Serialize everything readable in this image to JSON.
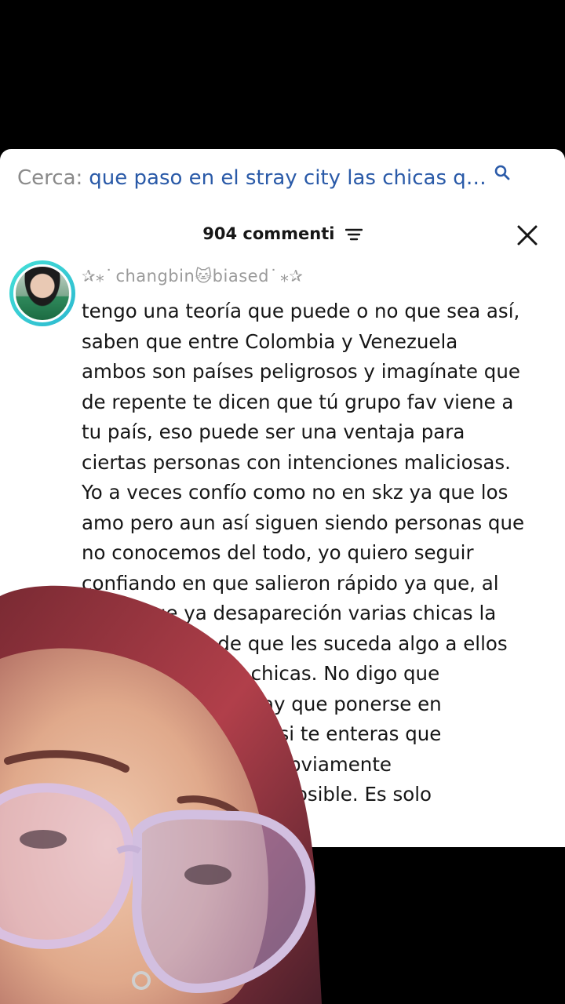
{
  "search": {
    "prefix": "Cerca:",
    "query": "que paso en el stray city las chicas qu..."
  },
  "comments": {
    "count_label": "904 commenti"
  },
  "comment": {
    "username": "✰⁎ ͘ changbin🐱biased ͘ ⁎✰",
    "lines": [
      "tengo una teoría que puede o no que sea así,",
      "saben que entre Colombia y Venezuela",
      "ambos son países peligrosos y imagínate que",
      "de repente te dicen que tú grupo fav viene a",
      "tu país, eso puede ser una ventaja para",
      "ciertas personas con intenciones maliciosas.",
      "Yo a veces confío como no en skz ya que los",
      "amo pero aun así siguen siendo personas que",
      "no conocemos del todo, yo quiero seguir",
      "confiando en que salieron rápido ya que, al",
      "saber que ya desapareción varias chicas la",
      "preocupación de que les suceda algo a ellos",
      "igual que con las chicas. No digo que",
      "sea verdad pero, hay que ponerse en",
      "sus zapatos ya que, si te enteras que",
      "están secuestrando obviamente",
      "te vas lo más rápido posible. Es solo"
    ]
  },
  "icons": {
    "search": "search-icon",
    "filter": "filter-icon",
    "close": "close-icon",
    "avatar": "avatar"
  }
}
